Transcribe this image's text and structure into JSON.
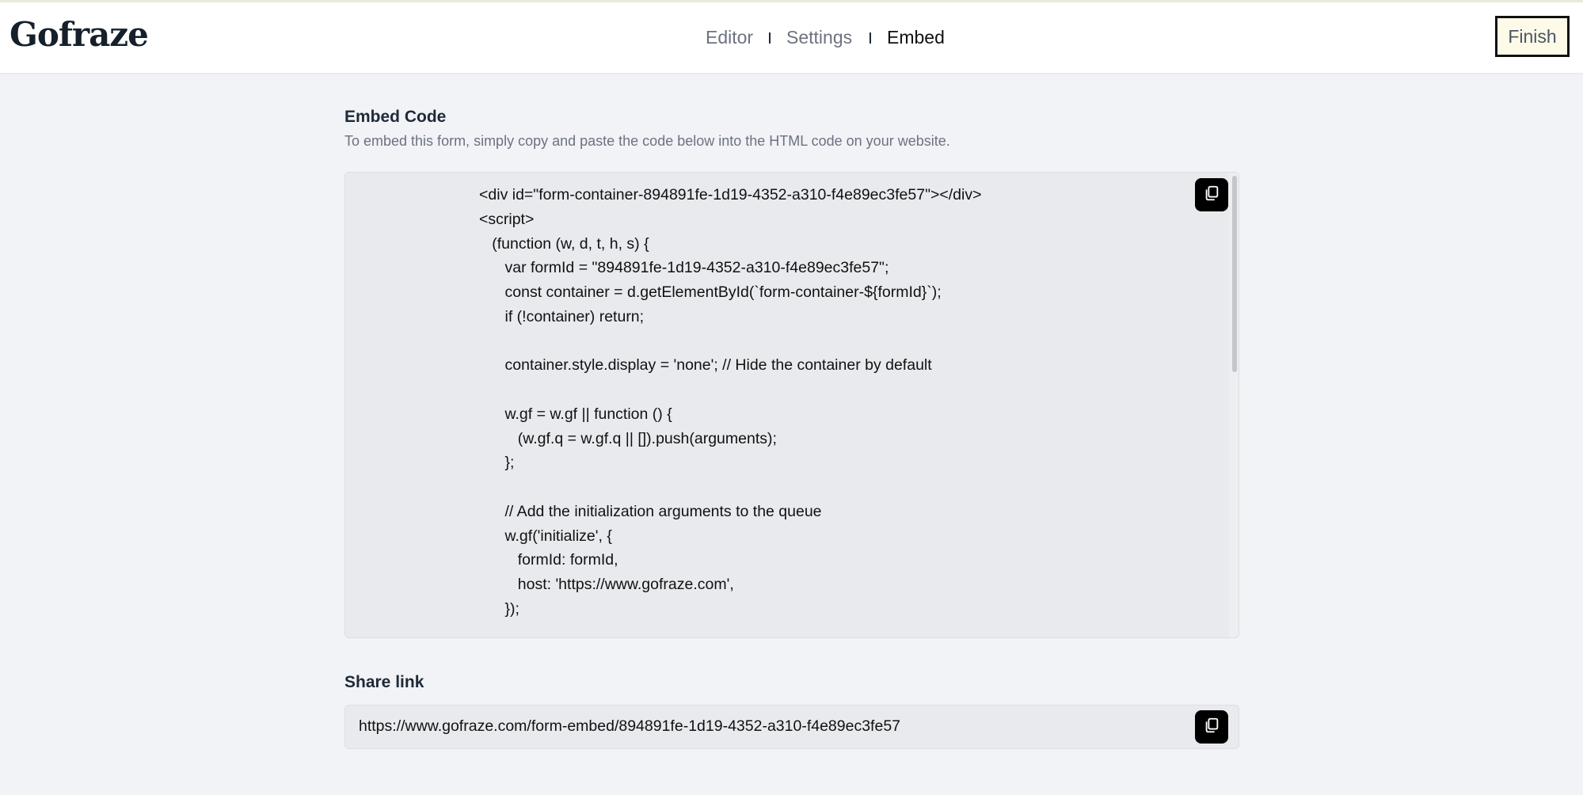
{
  "app": {
    "logo": "Gofraze"
  },
  "nav": {
    "tabs": [
      {
        "label": "Editor",
        "active": false
      },
      {
        "label": "Settings",
        "active": false
      },
      {
        "label": "Embed",
        "active": true
      }
    ],
    "finish_label": "Finish"
  },
  "embed": {
    "title": "Embed Code",
    "description": "To embed this form, simply copy and paste the code below into the HTML code on your website.",
    "code_lines": [
      "<div id=\"form-container-894891fe-1d19-4352-a310-f4e89ec3fe57\"></div>",
      "<script>",
      "   (function (w, d, t, h, s) {",
      "      var formId = \"894891fe-1d19-4352-a310-f4e89ec3fe57\";",
      "      const container = d.getElementById(`form-container-${formId}`);",
      "      if (!container) return;",
      "",
      "      container.style.display = 'none'; // Hide the container by default",
      "",
      "      w.gf = w.gf || function () {",
      "         (w.gf.q = w.gf.q || []).push(arguments);",
      "      };",
      "",
      "      // Add the initialization arguments to the queue",
      "      w.gf('initialize', {",
      "         formId: formId,",
      "         host: 'https://www.gofraze.com',",
      "      });"
    ],
    "copy_icon": "copy-icon"
  },
  "share": {
    "title": "Share link",
    "url": "https://www.gofraze.com/form-embed/894891fe-1d19-4352-a310-f4e89ec3fe57",
    "copy_icon": "copy-icon"
  },
  "colors": {
    "background": "#f2f3f7",
    "code_background": "#e9eaee",
    "finish_background": "#fdfbe8",
    "copy_button": "#000000"
  }
}
